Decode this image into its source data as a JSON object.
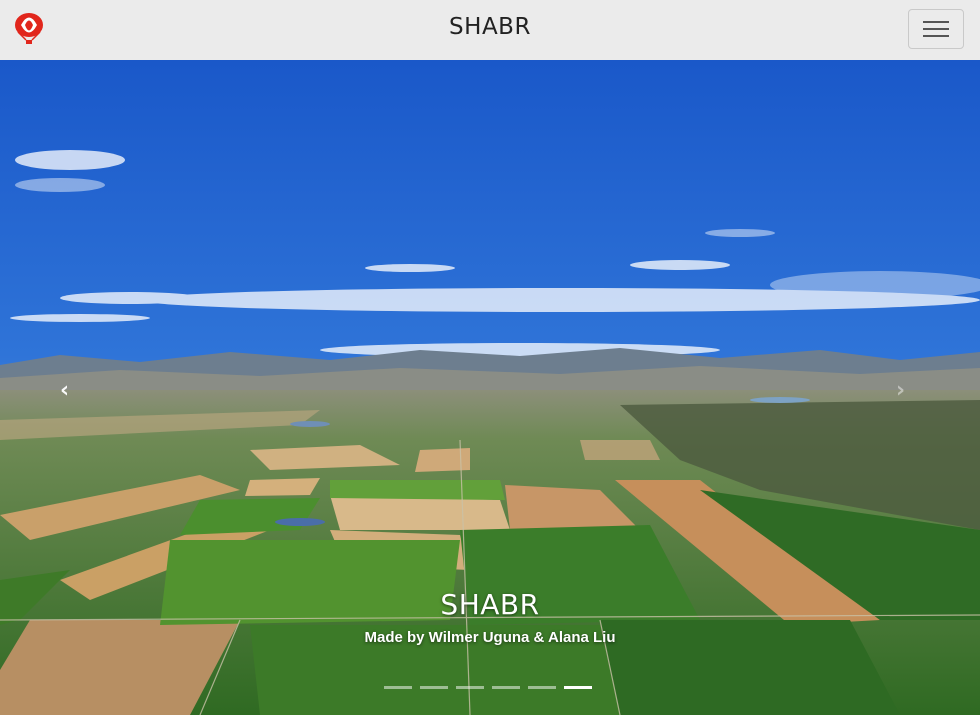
{
  "navbar": {
    "brand_title": "SHABR",
    "logo_icon": "hot-air-balloon-icon",
    "menu_icon": "hamburger-menu-icon",
    "background": "#ebebeb"
  },
  "carousel": {
    "prev_icon": "‹",
    "next_icon": "›",
    "caption_title": "SHABR",
    "caption_subtitle": "Made by Wilmer Uguna & Alana Liu",
    "slide_count": 6,
    "active_slide": 6,
    "image_description_icon": "aerial-landscape-photo"
  },
  "colors": {
    "sky_top": "#1d5fcf",
    "sky_bottom": "#6fa0e0",
    "field_green": "#3f7d2a",
    "field_tan": "#c9a06a",
    "balloon_red": "#e1261c"
  }
}
